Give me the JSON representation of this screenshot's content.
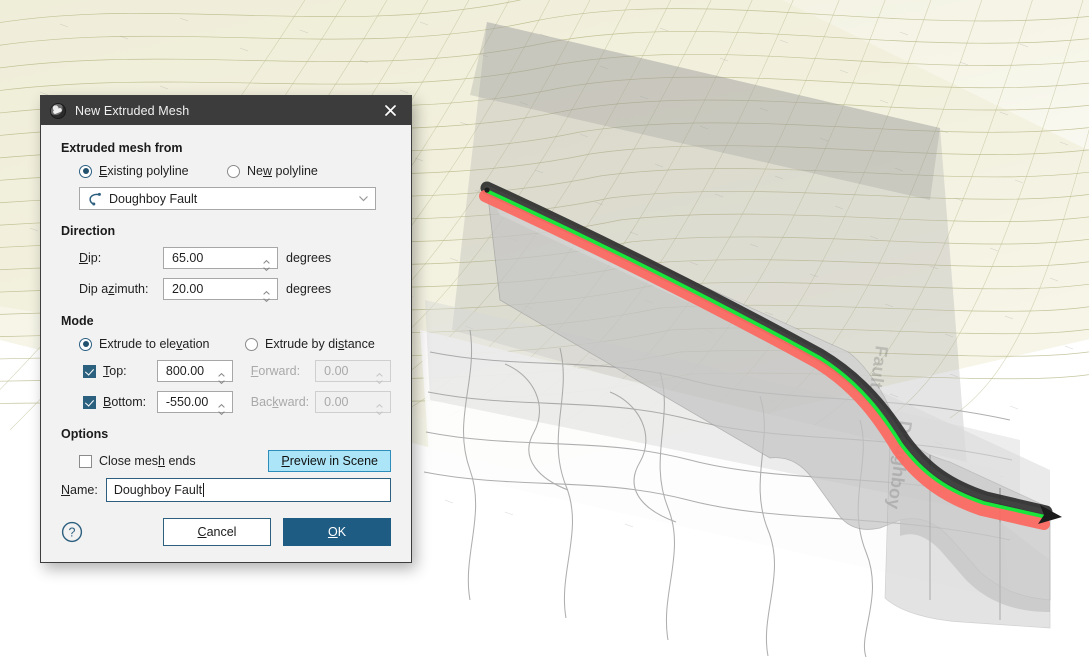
{
  "dialog": {
    "title": "New Extruded Mesh",
    "title_icon": "extruded-mesh-icon",
    "close_icon": "close-icon",
    "sections": {
      "source": {
        "label": "Extruded mesh from",
        "radio_existing": "Existing polyline",
        "radio_existing_selected": true,
        "radio_new": "New polyline",
        "radio_new_selected": false,
        "combo_value": "Doughboy Fault",
        "combo_icon": "polyline-icon",
        "combo_chevron": "chevron-down-icon"
      },
      "direction": {
        "label": "Direction",
        "dip_label": "Dip:",
        "dip_value": "65.00",
        "dip_units": "degrees",
        "azimuth_label": "Dip azimuth:",
        "azimuth_value": "20.00",
        "azimuth_units": "degrees"
      },
      "mode": {
        "label": "Mode",
        "radio_elevation": "Extrude to elevation",
        "radio_elevation_selected": true,
        "radio_distance": "Extrude by distance",
        "radio_distance_selected": false,
        "top_label": "Top:",
        "top_checked": true,
        "top_value": "800.00",
        "bottom_label": "Bottom:",
        "bottom_checked": true,
        "bottom_value": "-550.00",
        "forward_label": "Forward:",
        "forward_value": "0.00",
        "forward_enabled": false,
        "backward_label": "Backward:",
        "backward_value": "0.00",
        "backward_enabled": false
      },
      "options": {
        "label": "Options",
        "close_mesh_ends": "Close mesh ends",
        "close_mesh_ends_checked": false,
        "preview_button": "Preview in Scene"
      },
      "name": {
        "label": "Name:",
        "value": "Doughboy Fault"
      }
    },
    "footer": {
      "help_icon": "help-question-icon",
      "cancel": "Cancel",
      "ok": "OK"
    }
  },
  "scene": {
    "description": "3D geological scene with terrain wireframe and extruded fault mesh",
    "colors": {
      "terrain_wireframe": "#b9b98a",
      "terrain_fill": "#f2f1df",
      "mesh_surface": "#b8b8b8",
      "polyline_red": "#fa6a62",
      "polyline_green": "#18e63a",
      "polyline_black": "#1c1c1c",
      "contour_line": "#9a9a9a"
    }
  }
}
